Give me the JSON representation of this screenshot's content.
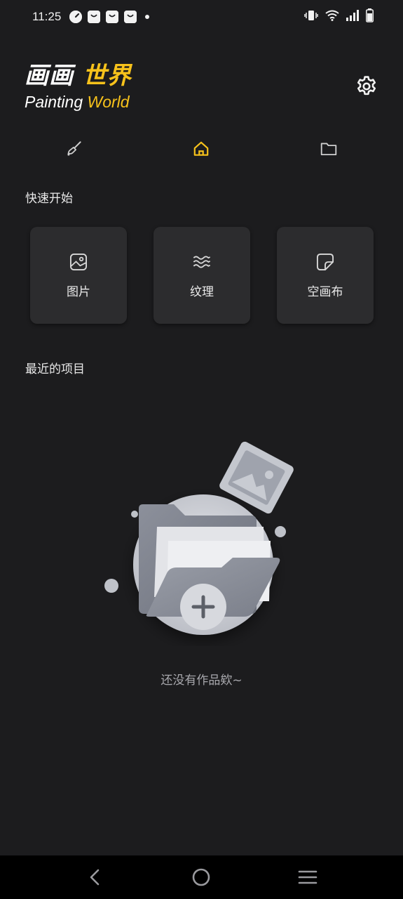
{
  "status_bar": {
    "time": "11:25",
    "notification_icons": [
      "speedometer-icon",
      "shopping-bag-icon",
      "shopping-bag-icon",
      "shopping-bag-icon",
      "dot-icon"
    ],
    "system_icons": [
      "vibrate-icon",
      "wifi-icon",
      "signal-icon",
      "battery-icon"
    ]
  },
  "header": {
    "logo_cn_part1": "画画",
    "logo_cn_part2": "世界",
    "logo_en_part1": "Painting",
    "logo_en_part2": "World",
    "settings_icon": "gear-icon"
  },
  "tabs": [
    {
      "icon": "brush-icon",
      "active": false
    },
    {
      "icon": "home-icon",
      "active": true
    },
    {
      "icon": "folder-icon",
      "active": false
    }
  ],
  "quick_start": {
    "title": "快速开始",
    "items": [
      {
        "label": "图片",
        "icon": "image-icon"
      },
      {
        "label": "纹理",
        "icon": "texture-waves-icon"
      },
      {
        "label": "空画布",
        "icon": "blank-canvas-icon"
      }
    ]
  },
  "recent": {
    "title": "最近的项目",
    "empty_text": "还没有作品欸~"
  },
  "colors": {
    "background": "#1c1c1e",
    "card": "#2c2c2e",
    "accent": "#f7c21b",
    "nav_bar": "#000000"
  },
  "nav_bar": {
    "buttons": [
      "back-icon",
      "home-circle-icon",
      "menu-icon"
    ]
  }
}
